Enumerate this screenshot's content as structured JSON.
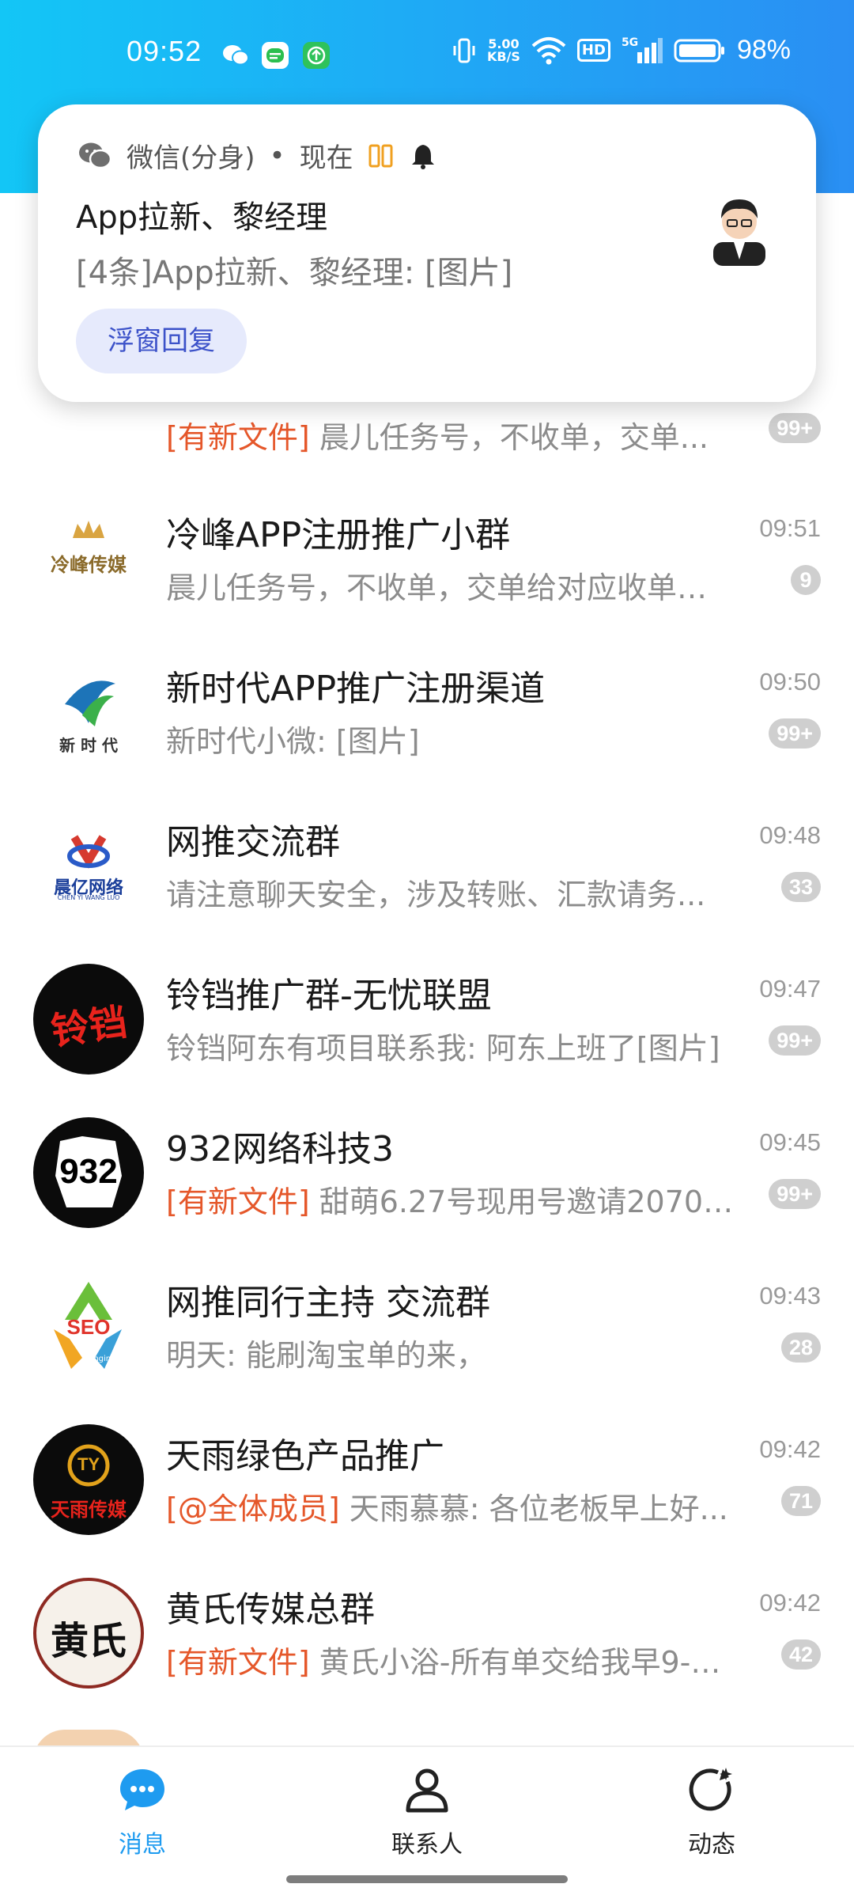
{
  "status_bar": {
    "time": "09:52",
    "net_speed_value": "5.00",
    "net_speed_unit": "KB/S",
    "hd": "HD",
    "signal_label": "5G",
    "battery": "98%"
  },
  "notification": {
    "app_name": "微信(分身)",
    "separator": "•",
    "when": "现在",
    "title": "App拉新、黎经理",
    "body": "[4条]App拉新、黎经理: [图片]",
    "reply_button": "浮窗回复"
  },
  "chats": [
    {
      "title": "",
      "tag": "[有新文件]",
      "preview": " 晨儿任务号，不收单，交单...",
      "time": "",
      "badge": "99+"
    },
    {
      "title": "冷峰APP注册推广小群",
      "tag": "",
      "preview": "晨儿任务号，不收单，交单给对应收单号:...",
      "time": "09:51",
      "badge": "9"
    },
    {
      "title": "新时代APP推广注册渠道",
      "tag": "",
      "preview": "新时代小微: [图片]",
      "time": "09:50",
      "badge": "99+"
    },
    {
      "title": "网推交流群",
      "tag": "",
      "preview": "请注意聊天安全，涉及转账、汇款请务...",
      "time": "09:48",
      "badge": "33"
    },
    {
      "title": "铃铛推广群-无忧联盟",
      "tag": "",
      "preview": "铃铛阿东有项目联系我: 阿东上班了[图片]",
      "time": "09:47",
      "badge": "99+"
    },
    {
      "title": "932网络科技3",
      "tag": "[有新文件]",
      "preview": " 甜萌6.27号现用号邀请20707...",
      "time": "09:45",
      "badge": "99+"
    },
    {
      "title": "网推同行主持  交流群",
      "tag": "",
      "preview": "明天: 能刷淘宝单的来，",
      "time": "09:43",
      "badge": "28"
    },
    {
      "title": "天雨绿色产品推广",
      "tag": "[@全体成员]",
      "preview": " 天雨慕慕: 各位老板早上好...",
      "time": "09:42",
      "badge": "71"
    },
    {
      "title": "黄氏传媒总群",
      "tag": "[有新文件]",
      "preview": " 黄氏小浴-所有单交给我早9-晚...",
      "time": "09:42",
      "badge": "42"
    }
  ],
  "avatar_text": {
    "lengfeng": "冷峰传媒",
    "xinshidai": "新 时 代",
    "chenyi": "晨亿网络",
    "chenyi_sub": "CHEN YI WANG LUO",
    "lingdang": "铃铛",
    "n932": "932",
    "seo": "SEO",
    "seo_engine": "Engine",
    "tianyu_logo": "TY",
    "tianyu": "天雨传媒",
    "huangshi": "黄氏"
  },
  "nav": [
    {
      "label": "消息",
      "icon": "message-icon",
      "active": true
    },
    {
      "label": "联系人",
      "icon": "contacts-icon",
      "active": false
    },
    {
      "label": "动态",
      "icon": "moments-icon",
      "active": false
    }
  ],
  "colors": {
    "header_blue": "#20a7f5",
    "accent_blue": "#1e9bf0",
    "tag_red": "#e5572a",
    "badge_grey": "#cfcfcf",
    "reply_btn_bg": "#e6eafc"
  }
}
